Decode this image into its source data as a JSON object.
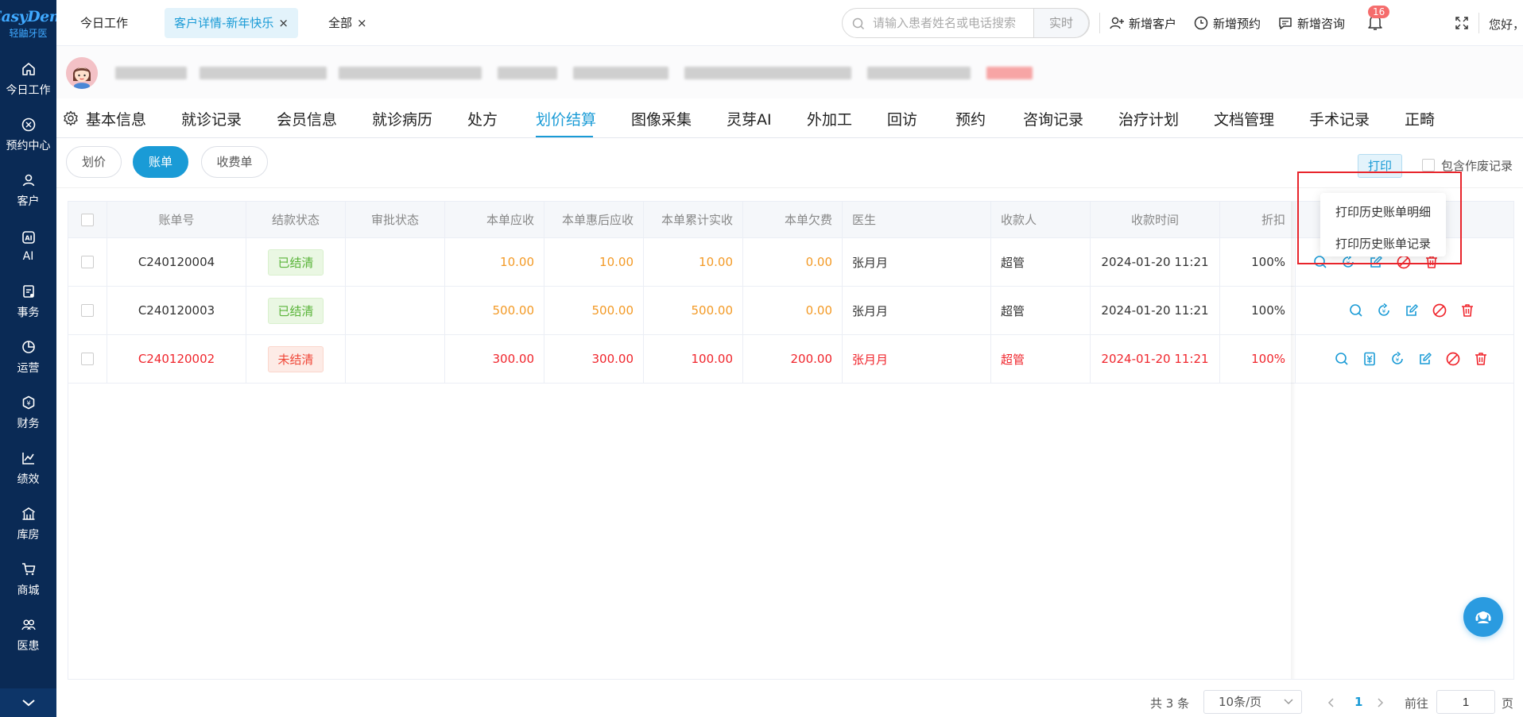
{
  "brand": {
    "name": "EasyDent",
    "sub": "轻鼬牙医"
  },
  "sidebar": {
    "items": [
      {
        "label": "今日工作",
        "icon": "home-icon"
      },
      {
        "label": "预约中心",
        "icon": "calendar-icon"
      },
      {
        "label": "客户",
        "icon": "user-icon"
      },
      {
        "label": "AI",
        "icon": "ai-icon"
      },
      {
        "label": "事务",
        "icon": "clipboard-icon"
      },
      {
        "label": "运营",
        "icon": "pie-chart-icon"
      },
      {
        "label": "财务",
        "icon": "wallet-icon"
      },
      {
        "label": "绩效",
        "icon": "line-chart-icon"
      },
      {
        "label": "库房",
        "icon": "warehouse-icon"
      },
      {
        "label": "商城",
        "icon": "cart-icon"
      },
      {
        "label": "医患",
        "icon": "users-icon"
      }
    ]
  },
  "top_tabs": [
    {
      "label": "今日工作"
    },
    {
      "label": "客户详情-新年快乐",
      "close": "×"
    },
    {
      "label": "全部",
      "close": "×"
    }
  ],
  "search": {
    "placeholder": "请输入患者姓名或电话搜索",
    "value": "",
    "realtime_label": "实时"
  },
  "top_actions": {
    "new_customer": "新增客户",
    "new_appointment": "新增预约",
    "new_consult": "新增咨询",
    "notification_count": "16",
    "greeting": "您好，超管"
  },
  "sub_tabs": {
    "items": [
      "基本信息",
      "就诊记录",
      "会员信息",
      "就诊病历",
      "处方",
      "划价结算",
      "图像采集",
      "灵芽AI",
      "外加工",
      "回访",
      "预约",
      "咨询记录",
      "治疗计划",
      "文档管理",
      "手术记录",
      "正畸"
    ],
    "active": "划价结算"
  },
  "bill_tabs": {
    "pricing": "划价",
    "bill": "账单",
    "receipt": "收费单"
  },
  "print": {
    "label": "打印",
    "include_void": "包含作废记录"
  },
  "print_menu": {
    "detail": "打印历史账单明细",
    "record": "打印历史账单记录"
  },
  "table": {
    "headers": [
      "账单号",
      "结款状态",
      "审批状态",
      "本单应收",
      "本单惠后应收",
      "本单累计实收",
      "本单欠费",
      "医生",
      "收款人",
      "收款时间",
      "折扣"
    ],
    "rows": [
      {
        "bill_no": "C240120004",
        "status": "已结清",
        "approval": "",
        "receivable": "10.00",
        "discounted": "10.00",
        "paid": "10.00",
        "owed": "0.00",
        "doctor": "张月月",
        "cashier": "超管",
        "time": "2024-01-20 11:21",
        "discount": "100%"
      },
      {
        "bill_no": "C240120003",
        "status": "已结清",
        "approval": "",
        "receivable": "500.00",
        "discounted": "500.00",
        "paid": "500.00",
        "owed": "0.00",
        "doctor": "张月月",
        "cashier": "超管",
        "time": "2024-01-20 11:21",
        "discount": "100%"
      },
      {
        "bill_no": "C240120002",
        "status": "未结清",
        "approval": "",
        "receivable": "300.00",
        "discounted": "300.00",
        "paid": "100.00",
        "owed": "200.00",
        "doctor": "张月月",
        "cashier": "超管",
        "time": "2024-01-20 11:21",
        "discount": "100%"
      }
    ]
  },
  "pagination": {
    "total": "共 3 条",
    "page_size": "10条/页",
    "current": "1",
    "goto_label": "前往",
    "goto_value": "1",
    "page_unit": "页"
  },
  "colors": {
    "accent": "#1a9bd6",
    "sidebar": "#0a2a55",
    "orange": "#f39a26",
    "red": "#f0262d",
    "success": "#5ab43a"
  }
}
